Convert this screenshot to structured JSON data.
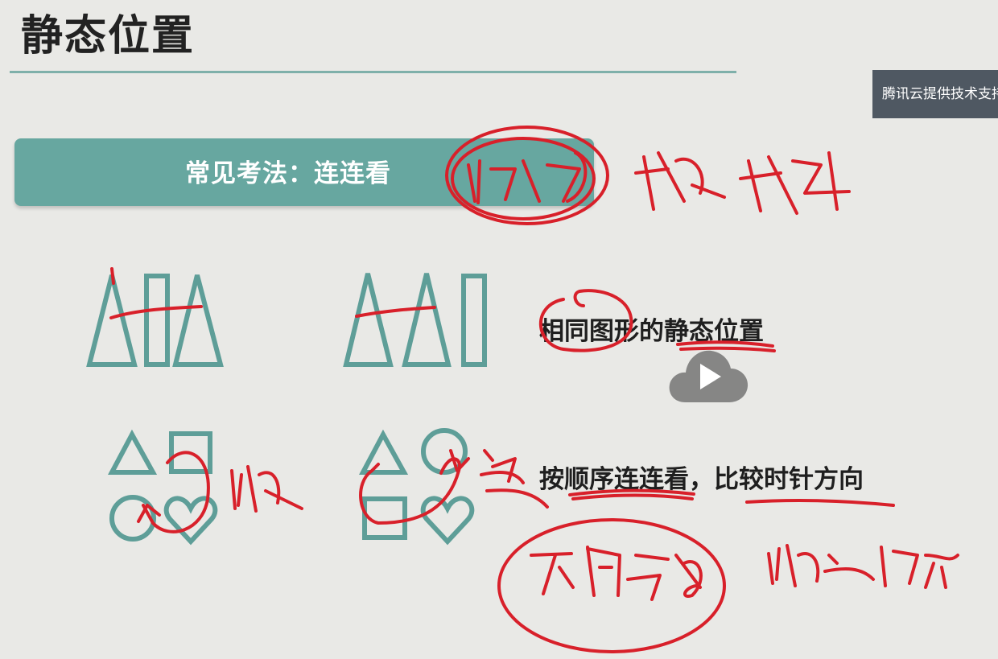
{
  "slide": {
    "title": "静态位置",
    "banner_label": "常见考法：连连看",
    "caption_same_shapes": "相同图形的静态位置",
    "caption_order": "按顺序连连看，比较时针方向"
  },
  "watermark": {
    "text": "腾讯云提供技术支持"
  },
  "player": {
    "play_icon": "play-icon"
  },
  "colors": {
    "accent": "#67a7a0",
    "shape_stroke": "#5e9e98",
    "ink": "#d8202a",
    "title": "#222222",
    "watermark_bg": "#4f5862"
  }
}
